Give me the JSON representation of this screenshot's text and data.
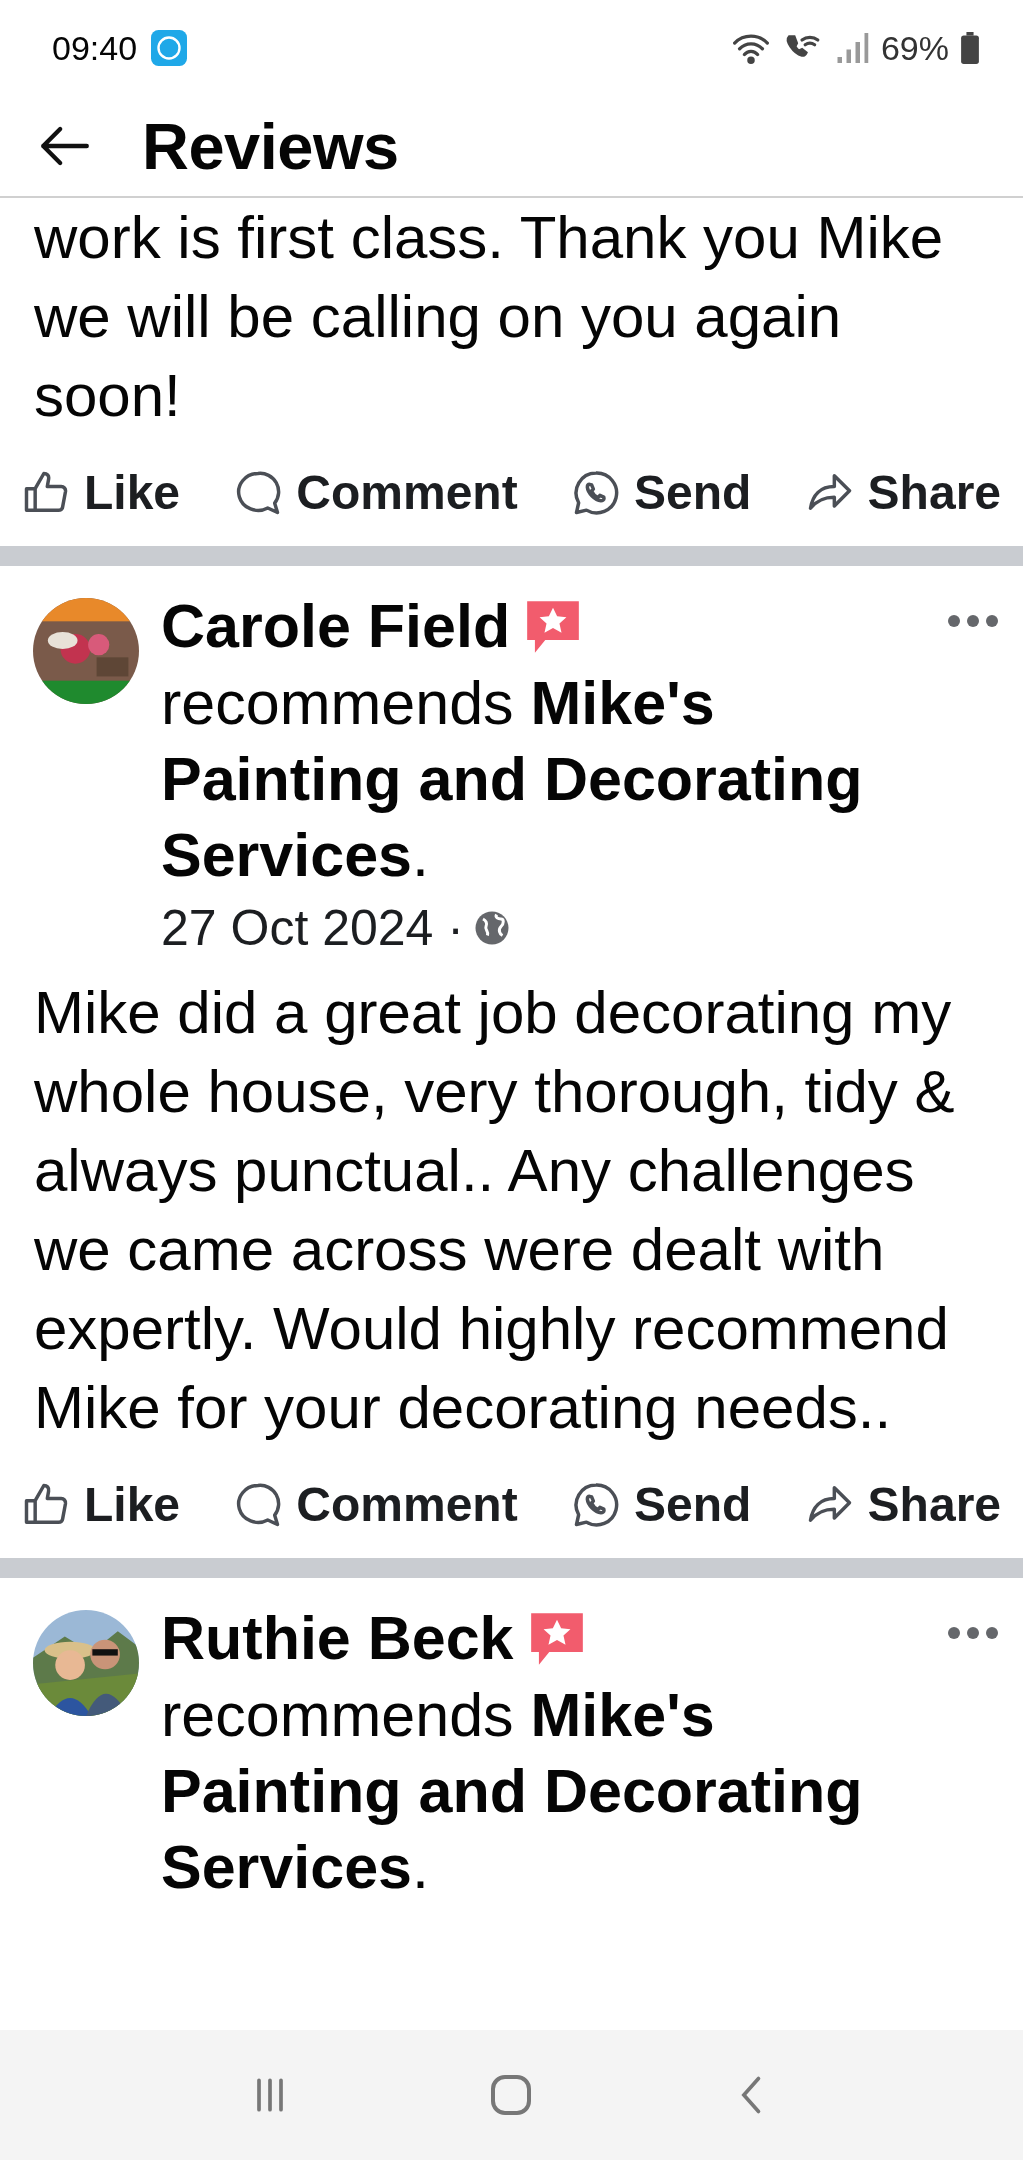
{
  "status_bar": {
    "time": "09:40",
    "battery": "69%"
  },
  "header": {
    "title": "Reviews"
  },
  "posts": [
    {
      "kind": "partial",
      "body": "work is first class. Thank you Mike we will be calling on you again soon!",
      "actions": [
        {
          "kind": "like",
          "label": "Like"
        },
        {
          "kind": "comment",
          "label": "Comment"
        },
        {
          "kind": "send",
          "label": "Send"
        },
        {
          "kind": "share",
          "label": "Share"
        }
      ]
    },
    {
      "kind": "full",
      "author": "Carole Field",
      "recommends": "recommends **Mike's Painting and Decorating Services**.",
      "date": "27 Oct 2024 ·",
      "body": "Mike did a great job decorating my whole house, very thorough, tidy & always punctual.. Any challenges we came across were dealt with expertly. Would highly recommend Mike for your decorating needs..",
      "actions": [
        {
          "kind": "like",
          "label": "Like"
        },
        {
          "kind": "comment",
          "label": "Comment"
        },
        {
          "kind": "send",
          "label": "Send"
        },
        {
          "kind": "share",
          "label": "Share"
        }
      ]
    },
    {
      "kind": "full",
      "author": "Ruthie Beck",
      "recommends": "recommends **Mike's Painting and Decorating Services**."
    }
  ]
}
